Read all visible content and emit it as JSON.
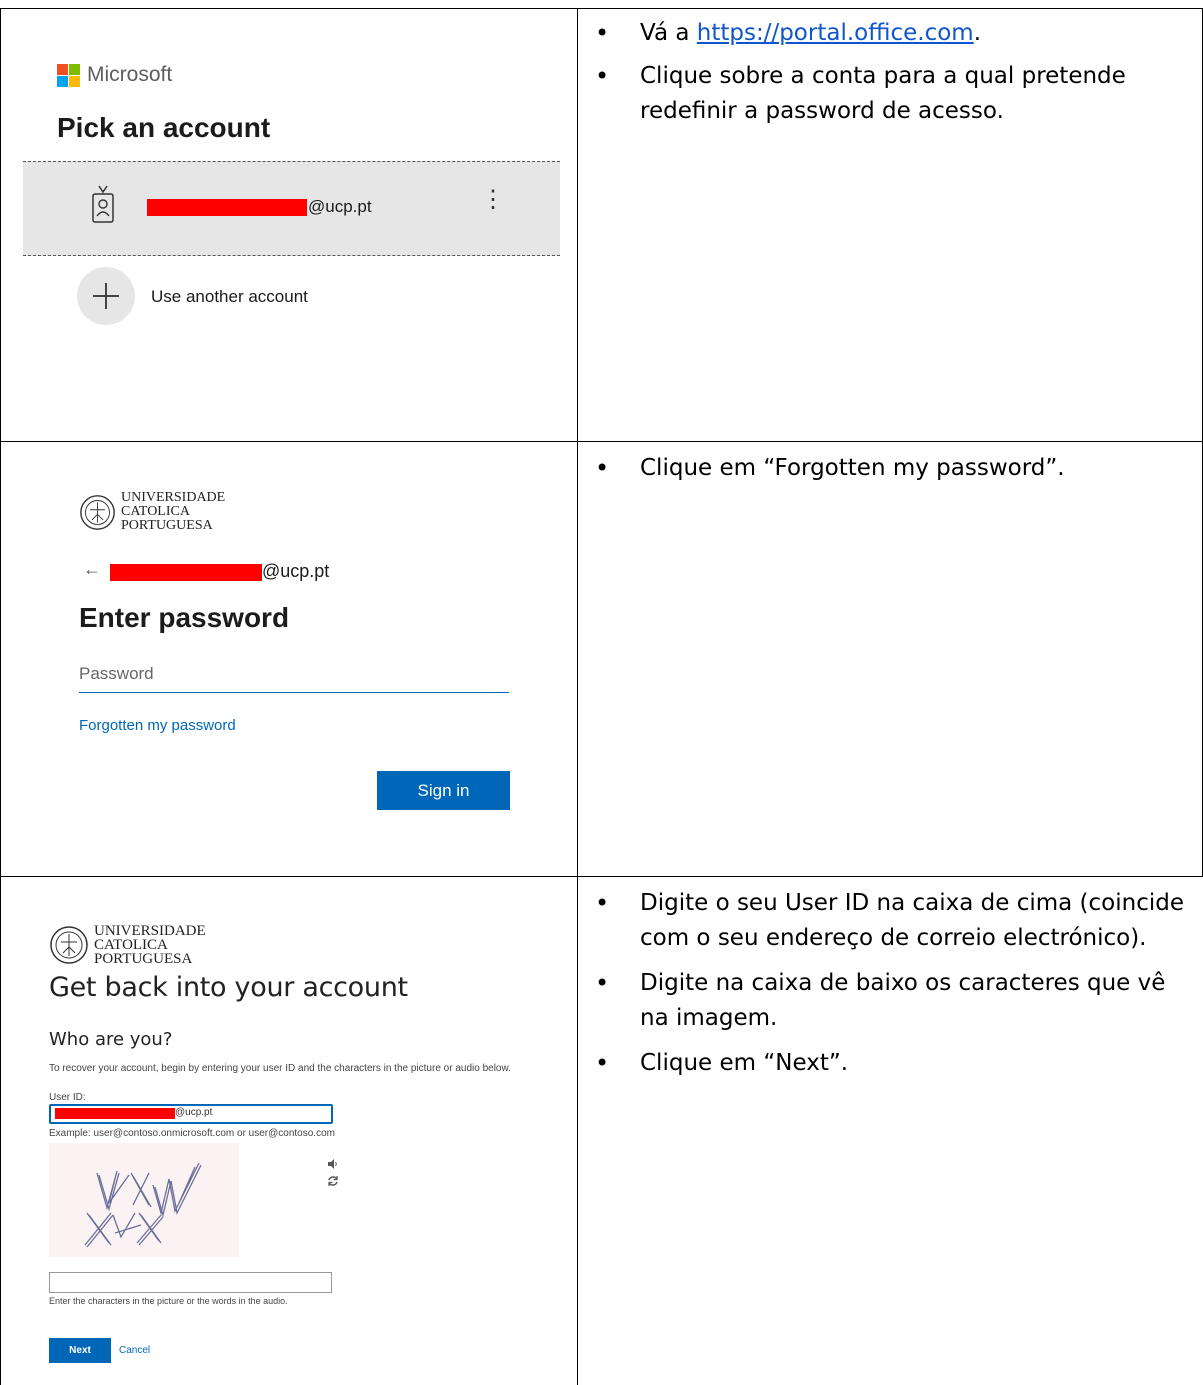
{
  "screenshot1": {
    "ms_brand": "Microsoft",
    "heading": "Pick an account",
    "account_email_suffix": "@ucp.pt",
    "kebab": "⋮",
    "use_another": "Use another account",
    "logo_colors": [
      "#f25022",
      "#7fba00",
      "#00a4ef",
      "#ffb900"
    ]
  },
  "instructions1": {
    "prefix": "Vá a ",
    "link": "https://portal.office.com",
    "suffix": ".",
    "item2": "Clique sobre a conta para a qual pretende redefinir a password de acesso."
  },
  "ucp_logo": {
    "line1": "UNIVERSIDADE",
    "line2": "CATOLICA",
    "line3": "PORTUGUESA"
  },
  "screenshot2": {
    "back_arrow": "←",
    "email_suffix": "@ucp.pt",
    "heading": "Enter password",
    "password_placeholder": "Password",
    "forgot_link": "Forgotten my password",
    "signin_label": "Sign in"
  },
  "instructions2": {
    "item1": "Clique em “Forgotten my password”."
  },
  "screenshot3": {
    "heading": "Get back into your account",
    "subheading": "Who are you?",
    "description": "To recover your account, begin by entering your user ID and the characters in the picture or audio below.",
    "user_id_label": "User ID:",
    "user_id_suffix": "@ucp.pt",
    "example": "Example: user@contoso.onmicrosoft.com or user@contoso.com",
    "captcha_hint": "Enter the characters in the picture or the words in the audio.",
    "next_label": "Next",
    "cancel_label": "Cancel"
  },
  "instructions3": {
    "item1": "Digite o seu User ID na caixa de cima (coincide com o seu endereço de correio electrónico).",
    "item2": "Digite na caixa de baixo os caracteres que vê na imagem.",
    "item3": "Clique em “Next”."
  },
  "colors": {
    "accent_blue": "#0067b8",
    "redaction": "#ff0000",
    "link_blue": "#1155cc"
  }
}
